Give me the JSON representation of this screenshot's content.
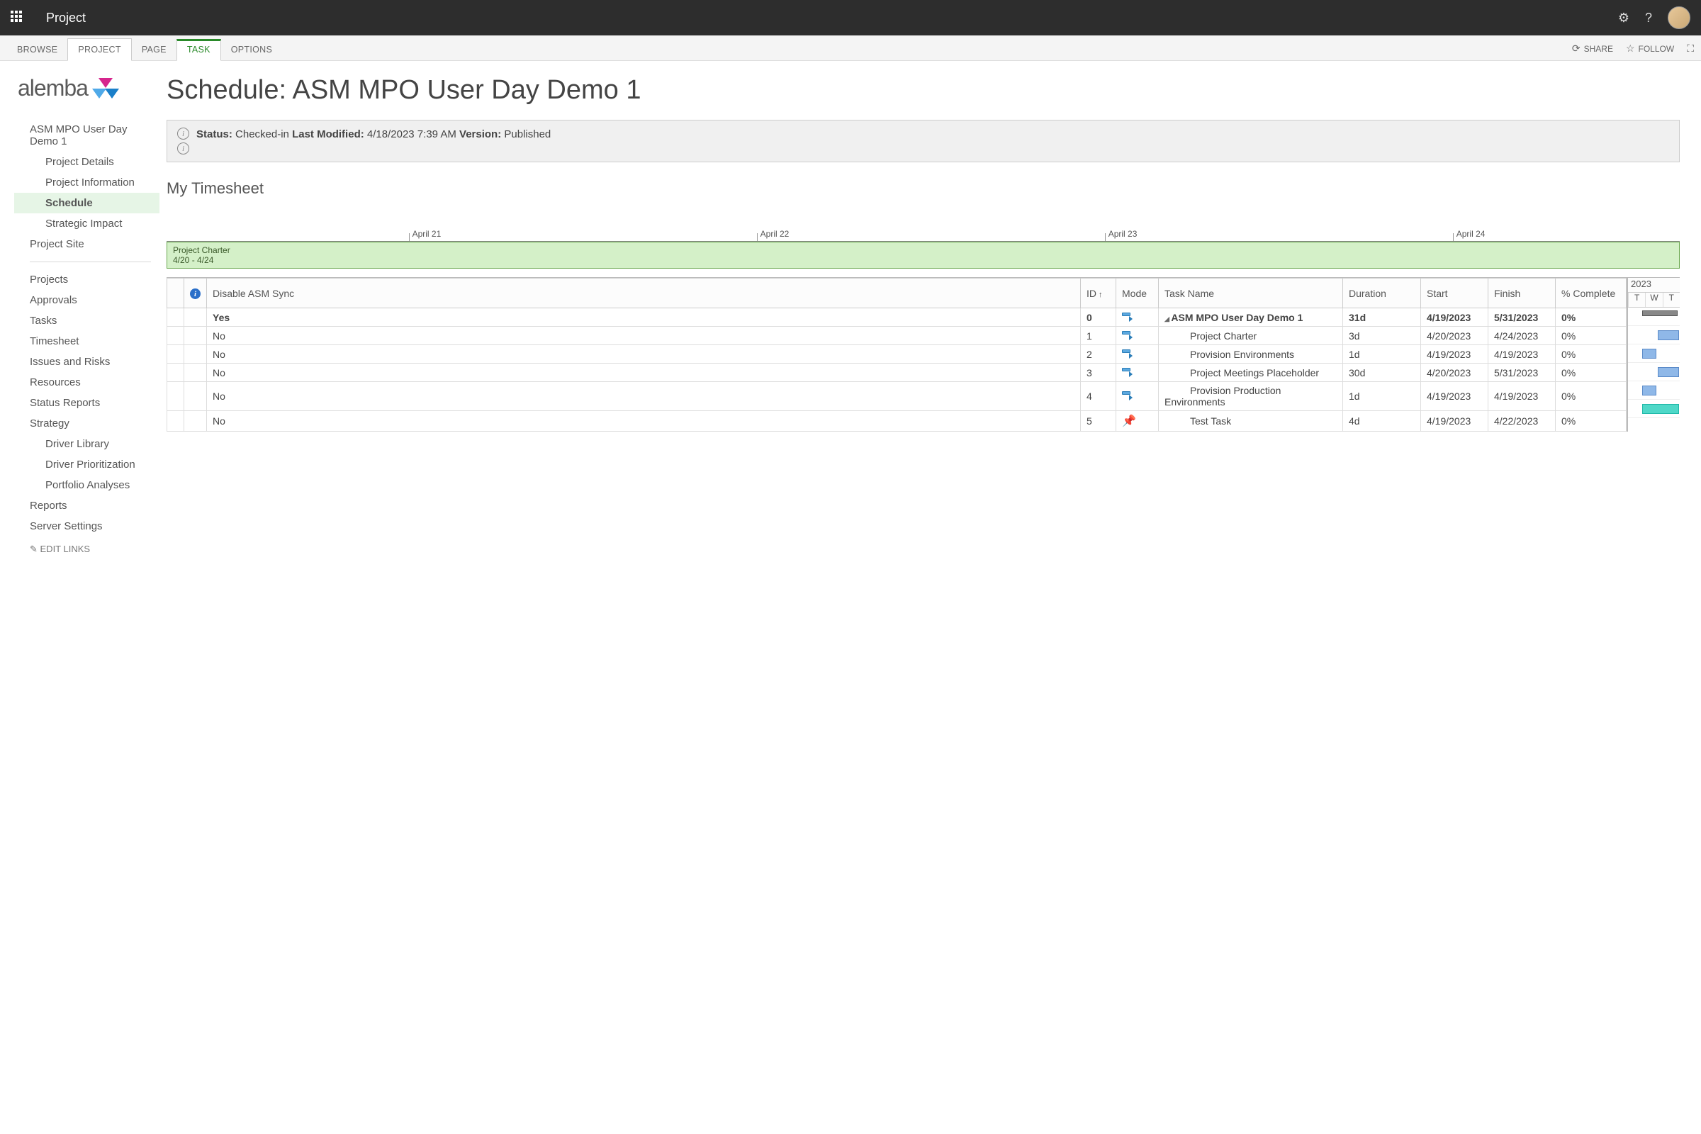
{
  "topbar": {
    "brand": "Project"
  },
  "ribbon": {
    "tabs": [
      "BROWSE",
      "PROJECT",
      "PAGE",
      "TASK",
      "OPTIONS"
    ],
    "share": "SHARE",
    "follow": "FOLLOW"
  },
  "logo": {
    "text": "alemba"
  },
  "nav": {
    "project_name": "ASM MPO User Day Demo 1",
    "project_sub": [
      "Project Details",
      "Project Information",
      "Schedule",
      "Strategic Impact"
    ],
    "project_site": "Project Site",
    "global": [
      "Projects",
      "Approvals",
      "Tasks",
      "Timesheet",
      "Issues and Risks",
      "Resources",
      "Status Reports",
      "Strategy"
    ],
    "strategy_sub": [
      "Driver Library",
      "Driver Prioritization",
      "Portfolio Analyses"
    ],
    "reports": "Reports",
    "server_settings": "Server Settings",
    "edit_links": "EDIT LINKS"
  },
  "page": {
    "title": "Schedule: ASM MPO User Day Demo 1",
    "status_label": "Status:",
    "status_value": "Checked-in",
    "modified_label": "Last Modified:",
    "modified_value": "4/18/2023 7:39 AM",
    "version_label": "Version:",
    "version_value": "Published",
    "timesheet_title": "My Timesheet"
  },
  "gantt_dates": [
    "April 21",
    "April 22",
    "April 23",
    "April 24"
  ],
  "gantt_bar": {
    "name": "Project Charter",
    "range": "4/20 - 4/24"
  },
  "grid": {
    "headers": {
      "disable_sync": "Disable ASM Sync",
      "id": "ID",
      "mode": "Mode",
      "task_name": "Task Name",
      "duration": "Duration",
      "start": "Start",
      "finish": "Finish",
      "pct": "% Complete"
    },
    "rows": [
      {
        "sync": "Yes",
        "id": "0",
        "mode": "auto",
        "name": "ASM MPO User Day Demo 1",
        "dur": "31d",
        "start": "4/19/2023",
        "finish": "5/31/2023",
        "pct": "0%",
        "bold": true,
        "expand": true
      },
      {
        "sync": "No",
        "id": "1",
        "mode": "auto",
        "name": "Project Charter",
        "dur": "3d",
        "start": "4/20/2023",
        "finish": "4/24/2023",
        "pct": "0%",
        "indent": 1
      },
      {
        "sync": "No",
        "id": "2",
        "mode": "auto",
        "name": "Provision Environments",
        "dur": "1d",
        "start": "4/19/2023",
        "finish": "4/19/2023",
        "pct": "0%",
        "indent": 1
      },
      {
        "sync": "No",
        "id": "3",
        "mode": "auto",
        "name": "Project Meetings Placeholder",
        "dur": "30d",
        "start": "4/20/2023",
        "finish": "5/31/2023",
        "pct": "0%",
        "indent": 1
      },
      {
        "sync": "No",
        "id": "4",
        "mode": "auto",
        "name": "Provision Production Environments",
        "dur": "1d",
        "start": "4/19/2023",
        "finish": "4/19/2023",
        "pct": "0%",
        "indent": 1
      },
      {
        "sync": "No",
        "id": "5",
        "mode": "pin",
        "name": "Test Task",
        "dur": "4d",
        "start": "4/19/2023",
        "finish": "4/22/2023",
        "pct": "0%",
        "indent": 1
      }
    ]
  },
  "ganttpane": {
    "year": "2023",
    "days": [
      "T",
      "W",
      "T"
    ]
  }
}
